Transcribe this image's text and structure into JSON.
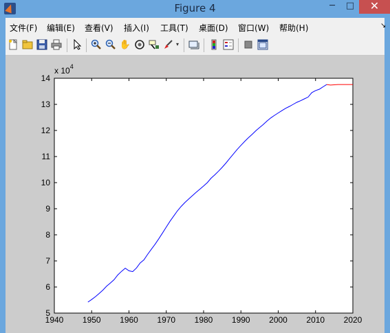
{
  "window": {
    "title": "Figure 4"
  },
  "menu": {
    "items": [
      "文件(F)",
      "编辑(E)",
      "查看(V)",
      "插入(I)",
      "工具(T)",
      "桌面(D)",
      "窗口(W)",
      "帮助(H)"
    ]
  },
  "toolbar": {
    "icons": [
      "new-figure-icon",
      "open-folder-icon",
      "save-icon",
      "print-icon",
      "pointer-icon",
      "zoom-in-icon",
      "zoom-out-icon",
      "pan-hand-icon",
      "rotate-3d-icon",
      "data-cursor-icon",
      "brush-icon",
      "link-plot-icon",
      "colorbar-icon",
      "legend-icon",
      "hide-plot-tools-icon",
      "show-plot-tools-icon"
    ]
  },
  "colors": {
    "series_blue": "#0000ff",
    "series_red": "#ff0000"
  },
  "chart_data": {
    "type": "line",
    "title": "",
    "xlabel": "",
    "ylabel": "",
    "y_exponent_label": "x 10",
    "y_exponent_power": "4",
    "xlim": [
      1940,
      2020
    ],
    "ylim": [
      5,
      14
    ],
    "xticks": [
      1940,
      1950,
      1960,
      1970,
      1980,
      1990,
      2000,
      2010,
      2020
    ],
    "yticks": [
      5,
      6,
      7,
      8,
      9,
      10,
      11,
      12,
      13,
      14
    ],
    "series": [
      {
        "color": "#0000ff",
        "x": [
          1949,
          1950,
          1951,
          1952,
          1953,
          1954,
          1955,
          1956,
          1957,
          1958,
          1959,
          1960,
          1961,
          1962,
          1963,
          1964,
          1965,
          1966,
          1967,
          1968,
          1969,
          1970,
          1971,
          1972,
          1973,
          1974,
          1975,
          1976,
          1977,
          1978,
          1979,
          1980,
          1981,
          1982,
          1983,
          1984,
          1985,
          1986,
          1987,
          1988,
          1989,
          1990,
          1991,
          1992,
          1993,
          1994,
          1995,
          1996,
          1997,
          1998,
          1999,
          2000,
          2001,
          2002,
          2003,
          2004,
          2005,
          2006,
          2007,
          2008,
          2009,
          2010,
          2011,
          2012,
          2013
        ],
        "values": [
          5.42,
          5.52,
          5.63,
          5.75,
          5.88,
          6.03,
          6.15,
          6.28,
          6.46,
          6.6,
          6.72,
          6.62,
          6.59,
          6.73,
          6.92,
          7.04,
          7.25,
          7.45,
          7.64,
          7.85,
          8.07,
          8.3,
          8.52,
          8.72,
          8.92,
          9.09,
          9.24,
          9.37,
          9.5,
          9.63,
          9.75,
          9.87,
          10.0,
          10.17,
          10.3,
          10.44,
          10.59,
          10.75,
          10.93,
          11.1,
          11.27,
          11.43,
          11.58,
          11.72,
          11.85,
          11.99,
          12.11,
          12.23,
          12.36,
          12.48,
          12.58,
          12.67,
          12.76,
          12.85,
          12.92,
          13.0,
          13.08,
          13.14,
          13.21,
          13.28,
          13.45,
          13.53,
          13.58,
          13.67,
          13.76
        ]
      },
      {
        "color": "#ff0000",
        "x": [
          2013,
          2014,
          2015,
          2016,
          2017,
          2018,
          2019,
          2020
        ],
        "values": [
          13.76,
          13.74,
          13.75,
          13.76,
          13.76,
          13.76,
          13.76,
          13.76
        ]
      }
    ]
  }
}
